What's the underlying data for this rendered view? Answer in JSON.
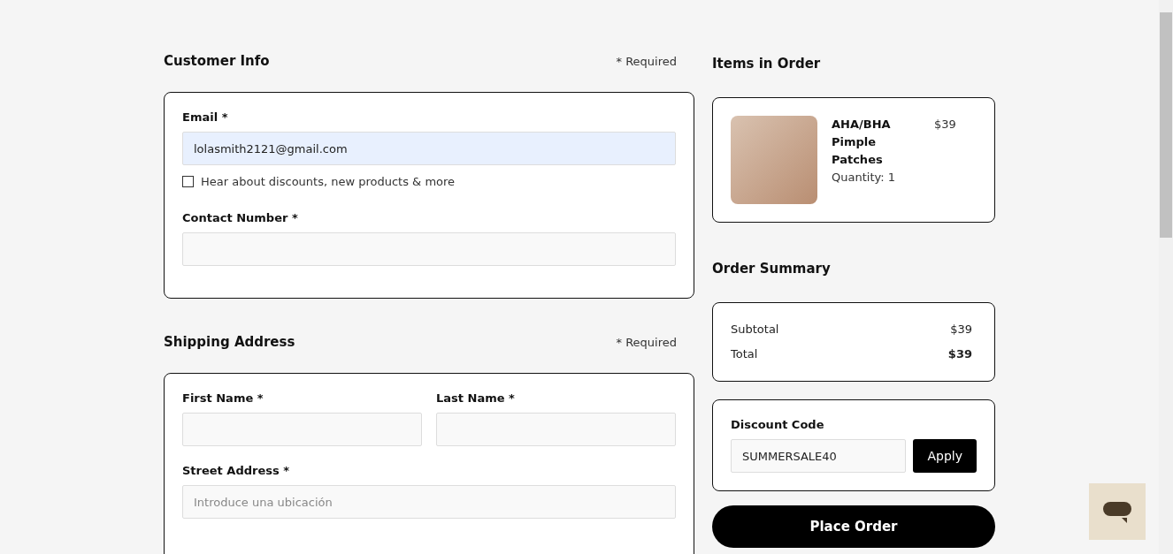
{
  "customer_info": {
    "title": "Customer Info",
    "required_note": "* Required",
    "email": {
      "label": "Email *",
      "value": "lolasmith2121@gmail.com",
      "autofilled": true
    },
    "newsletter": {
      "label": "Hear about discounts, new products & more",
      "checked": false
    },
    "contact": {
      "label": "Contact Number *"
    }
  },
  "shipping_address": {
    "title": "Shipping Address",
    "required_note": "* Required",
    "first_name": {
      "label": "First Name *"
    },
    "last_name": {
      "label": "Last Name *"
    },
    "street": {
      "label": "Street Address *",
      "placeholder": "Introduce una ubicación"
    }
  },
  "items_in_order": {
    "title": "Items in Order",
    "items": [
      {
        "name": "AHA/BHA Pimple Patches",
        "quantity": "Quantity: 1",
        "price": "$39"
      }
    ]
  },
  "order_summary": {
    "title": "Order Summary",
    "rows": [
      {
        "label": "Subtotal",
        "value": "$39",
        "bold": false
      },
      {
        "label": "Total",
        "value": "$39",
        "bold": true
      }
    ]
  },
  "discount": {
    "label": "Discount Code",
    "value": "SUMMERSALE40",
    "button": "Apply"
  },
  "place_order": "Place Order"
}
